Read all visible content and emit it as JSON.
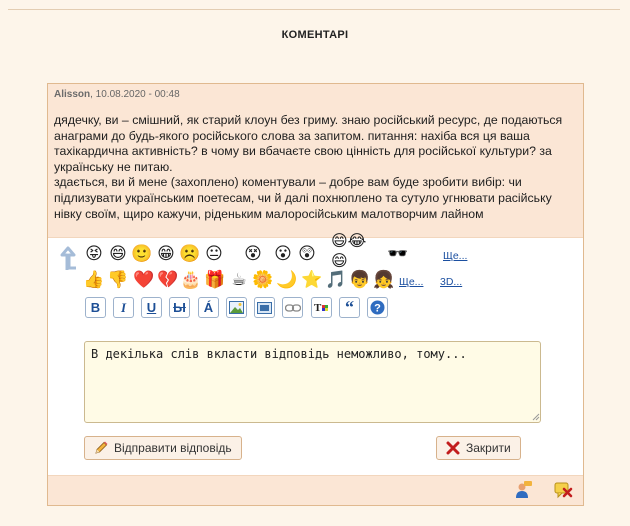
{
  "section": {
    "title": "КОМЕНТАРІ"
  },
  "comment": {
    "author": "Alisson",
    "date": ", 10.08.2020 - 00:48",
    "text": "дядечку, ви – смішний, як старий клоун без гриму. знаю російський ресурс, де подаються анаграми до будь-якого російського слова за запитом. питання: нахіба вся ця ваша тахікардична активність? в чому ви вбачаєте свою цінність для російської культури? за українську не питаю.\nздається, ви й мене (захоплено) коментували – добре вам буде зробити вибір: чи підлизувати українським поетесам, чи й далі похнюплено та сутуло угнювати расійську нівку своїм, щиро кажучи, ріденьким малоросійським малотворчим лайном"
  },
  "emoticons_row1": [
    "😝",
    "😄",
    "🙂",
    "😁",
    "☹️",
    "😐",
    "😵",
    "😮",
    "😲"
  ],
  "emoticons_row2": [
    "👍",
    "👎",
    "❤️",
    "💔",
    "🎂",
    "🎁",
    "☕",
    "🌼",
    "🌙",
    "⭐",
    "🎵",
    "👦",
    "👧"
  ],
  "links": {
    "more": "Ще...",
    "more2": "Ще...",
    "threed": "3D..."
  },
  "format_buttons": [
    "B",
    "I",
    "U",
    "Ы",
    "Á",
    "",
    "",
    "",
    "T",
    "“",
    "?"
  ],
  "reply": {
    "value": "В декілька слів вкласти відповідь неможливо, тому..."
  },
  "buttons": {
    "send": "Відправити відповідь",
    "close": "Закрити"
  },
  "colors": {
    "accent": "#1b4fa0",
    "panel_bg": "#fbe6d5",
    "page_bg": "#fdf5ea"
  }
}
